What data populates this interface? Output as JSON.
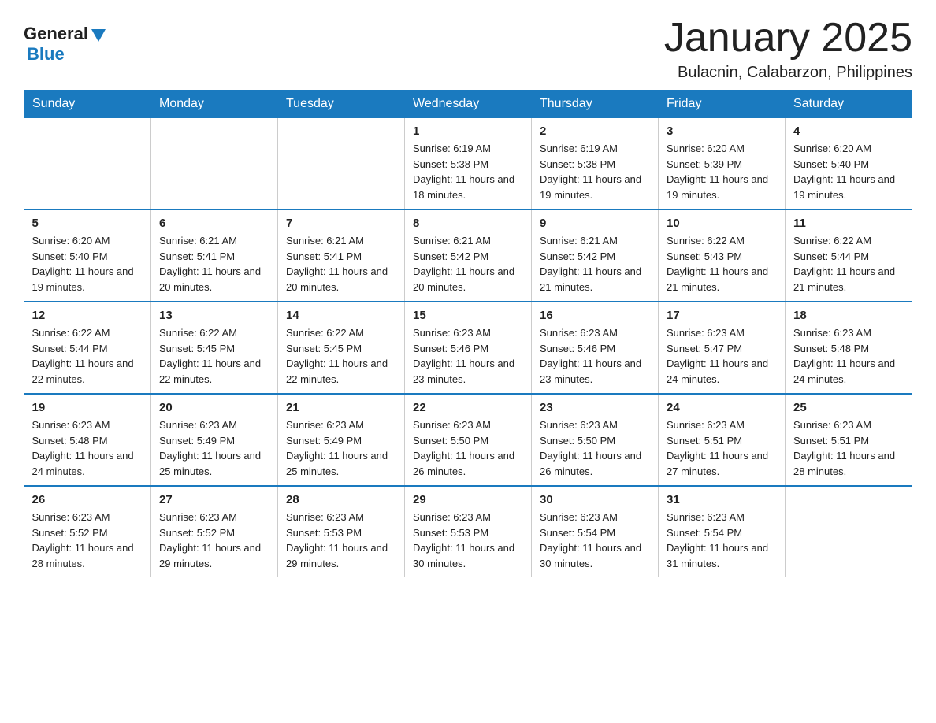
{
  "header": {
    "logo_general": "General",
    "logo_blue": "Blue",
    "month_title": "January 2025",
    "location": "Bulacnin, Calabarzon, Philippines"
  },
  "days_of_week": [
    "Sunday",
    "Monday",
    "Tuesday",
    "Wednesday",
    "Thursday",
    "Friday",
    "Saturday"
  ],
  "weeks": [
    {
      "days": [
        {
          "num": "",
          "info": ""
        },
        {
          "num": "",
          "info": ""
        },
        {
          "num": "",
          "info": ""
        },
        {
          "num": "1",
          "info": "Sunrise: 6:19 AM\nSunset: 5:38 PM\nDaylight: 11 hours and 18 minutes."
        },
        {
          "num": "2",
          "info": "Sunrise: 6:19 AM\nSunset: 5:38 PM\nDaylight: 11 hours and 19 minutes."
        },
        {
          "num": "3",
          "info": "Sunrise: 6:20 AM\nSunset: 5:39 PM\nDaylight: 11 hours and 19 minutes."
        },
        {
          "num": "4",
          "info": "Sunrise: 6:20 AM\nSunset: 5:40 PM\nDaylight: 11 hours and 19 minutes."
        }
      ]
    },
    {
      "days": [
        {
          "num": "5",
          "info": "Sunrise: 6:20 AM\nSunset: 5:40 PM\nDaylight: 11 hours and 19 minutes."
        },
        {
          "num": "6",
          "info": "Sunrise: 6:21 AM\nSunset: 5:41 PM\nDaylight: 11 hours and 20 minutes."
        },
        {
          "num": "7",
          "info": "Sunrise: 6:21 AM\nSunset: 5:41 PM\nDaylight: 11 hours and 20 minutes."
        },
        {
          "num": "8",
          "info": "Sunrise: 6:21 AM\nSunset: 5:42 PM\nDaylight: 11 hours and 20 minutes."
        },
        {
          "num": "9",
          "info": "Sunrise: 6:21 AM\nSunset: 5:42 PM\nDaylight: 11 hours and 21 minutes."
        },
        {
          "num": "10",
          "info": "Sunrise: 6:22 AM\nSunset: 5:43 PM\nDaylight: 11 hours and 21 minutes."
        },
        {
          "num": "11",
          "info": "Sunrise: 6:22 AM\nSunset: 5:44 PM\nDaylight: 11 hours and 21 minutes."
        }
      ]
    },
    {
      "days": [
        {
          "num": "12",
          "info": "Sunrise: 6:22 AM\nSunset: 5:44 PM\nDaylight: 11 hours and 22 minutes."
        },
        {
          "num": "13",
          "info": "Sunrise: 6:22 AM\nSunset: 5:45 PM\nDaylight: 11 hours and 22 minutes."
        },
        {
          "num": "14",
          "info": "Sunrise: 6:22 AM\nSunset: 5:45 PM\nDaylight: 11 hours and 22 minutes."
        },
        {
          "num": "15",
          "info": "Sunrise: 6:23 AM\nSunset: 5:46 PM\nDaylight: 11 hours and 23 minutes."
        },
        {
          "num": "16",
          "info": "Sunrise: 6:23 AM\nSunset: 5:46 PM\nDaylight: 11 hours and 23 minutes."
        },
        {
          "num": "17",
          "info": "Sunrise: 6:23 AM\nSunset: 5:47 PM\nDaylight: 11 hours and 24 minutes."
        },
        {
          "num": "18",
          "info": "Sunrise: 6:23 AM\nSunset: 5:48 PM\nDaylight: 11 hours and 24 minutes."
        }
      ]
    },
    {
      "days": [
        {
          "num": "19",
          "info": "Sunrise: 6:23 AM\nSunset: 5:48 PM\nDaylight: 11 hours and 24 minutes."
        },
        {
          "num": "20",
          "info": "Sunrise: 6:23 AM\nSunset: 5:49 PM\nDaylight: 11 hours and 25 minutes."
        },
        {
          "num": "21",
          "info": "Sunrise: 6:23 AM\nSunset: 5:49 PM\nDaylight: 11 hours and 25 minutes."
        },
        {
          "num": "22",
          "info": "Sunrise: 6:23 AM\nSunset: 5:50 PM\nDaylight: 11 hours and 26 minutes."
        },
        {
          "num": "23",
          "info": "Sunrise: 6:23 AM\nSunset: 5:50 PM\nDaylight: 11 hours and 26 minutes."
        },
        {
          "num": "24",
          "info": "Sunrise: 6:23 AM\nSunset: 5:51 PM\nDaylight: 11 hours and 27 minutes."
        },
        {
          "num": "25",
          "info": "Sunrise: 6:23 AM\nSunset: 5:51 PM\nDaylight: 11 hours and 28 minutes."
        }
      ]
    },
    {
      "days": [
        {
          "num": "26",
          "info": "Sunrise: 6:23 AM\nSunset: 5:52 PM\nDaylight: 11 hours and 28 minutes."
        },
        {
          "num": "27",
          "info": "Sunrise: 6:23 AM\nSunset: 5:52 PM\nDaylight: 11 hours and 29 minutes."
        },
        {
          "num": "28",
          "info": "Sunrise: 6:23 AM\nSunset: 5:53 PM\nDaylight: 11 hours and 29 minutes."
        },
        {
          "num": "29",
          "info": "Sunrise: 6:23 AM\nSunset: 5:53 PM\nDaylight: 11 hours and 30 minutes."
        },
        {
          "num": "30",
          "info": "Sunrise: 6:23 AM\nSunset: 5:54 PM\nDaylight: 11 hours and 30 minutes."
        },
        {
          "num": "31",
          "info": "Sunrise: 6:23 AM\nSunset: 5:54 PM\nDaylight: 11 hours and 31 minutes."
        },
        {
          "num": "",
          "info": ""
        }
      ]
    }
  ]
}
